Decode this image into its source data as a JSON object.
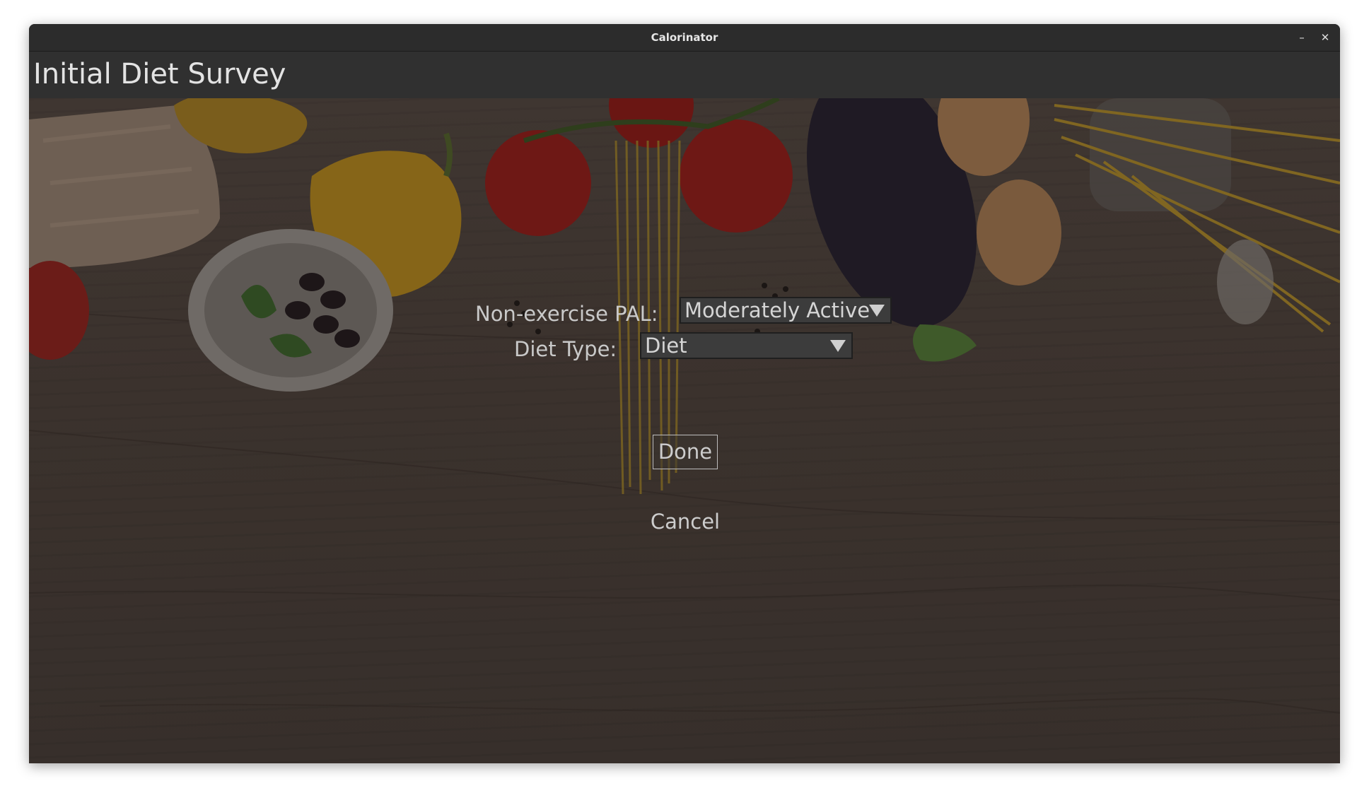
{
  "window": {
    "title": "Calorinator",
    "minimize_glyph": "–",
    "close_glyph": "✕"
  },
  "header": {
    "title": "Initial Diet Survey"
  },
  "form": {
    "pal_label": "Non-exercise PAL:",
    "pal_value": "Moderately Active",
    "diet_label": "Diet Type:",
    "diet_value": "Diet",
    "done_label": "Done",
    "cancel_label": "Cancel"
  },
  "icons": {
    "dropdown": "triangle-down-icon",
    "minimize": "minimize-icon",
    "close": "close-icon"
  },
  "colors": {
    "titlebar": "#2c2c2c",
    "header": "#303030",
    "wood_background": "#3b322d",
    "text": "#cdcdcd"
  }
}
